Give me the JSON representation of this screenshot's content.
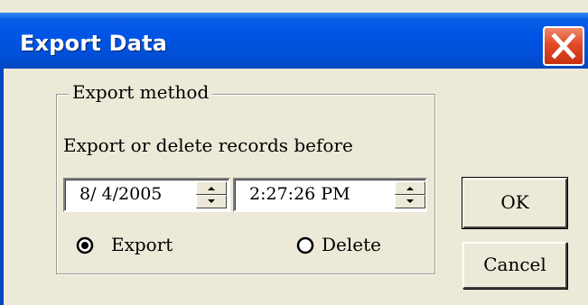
{
  "window": {
    "title": "Export Data"
  },
  "group": {
    "legend": "Export method",
    "instruction": "Export or delete records before"
  },
  "date_field": {
    "value": "8/ 4/2005"
  },
  "time_field": {
    "value": "2:27:26 PM"
  },
  "radios": {
    "export_label": "Export",
    "delete_label": "Delete",
    "selected": "Export"
  },
  "buttons": {
    "ok_label": "OK",
    "cancel_label": "Cancel"
  },
  "colors": {
    "titlebar": "#0055e5",
    "close_button": "#e24a28",
    "dialog_background": "#ece9d8"
  },
  "icons": {
    "close": "close-x-icon",
    "spin_up": "spin-up-icon",
    "spin_down": "spin-down-icon"
  }
}
